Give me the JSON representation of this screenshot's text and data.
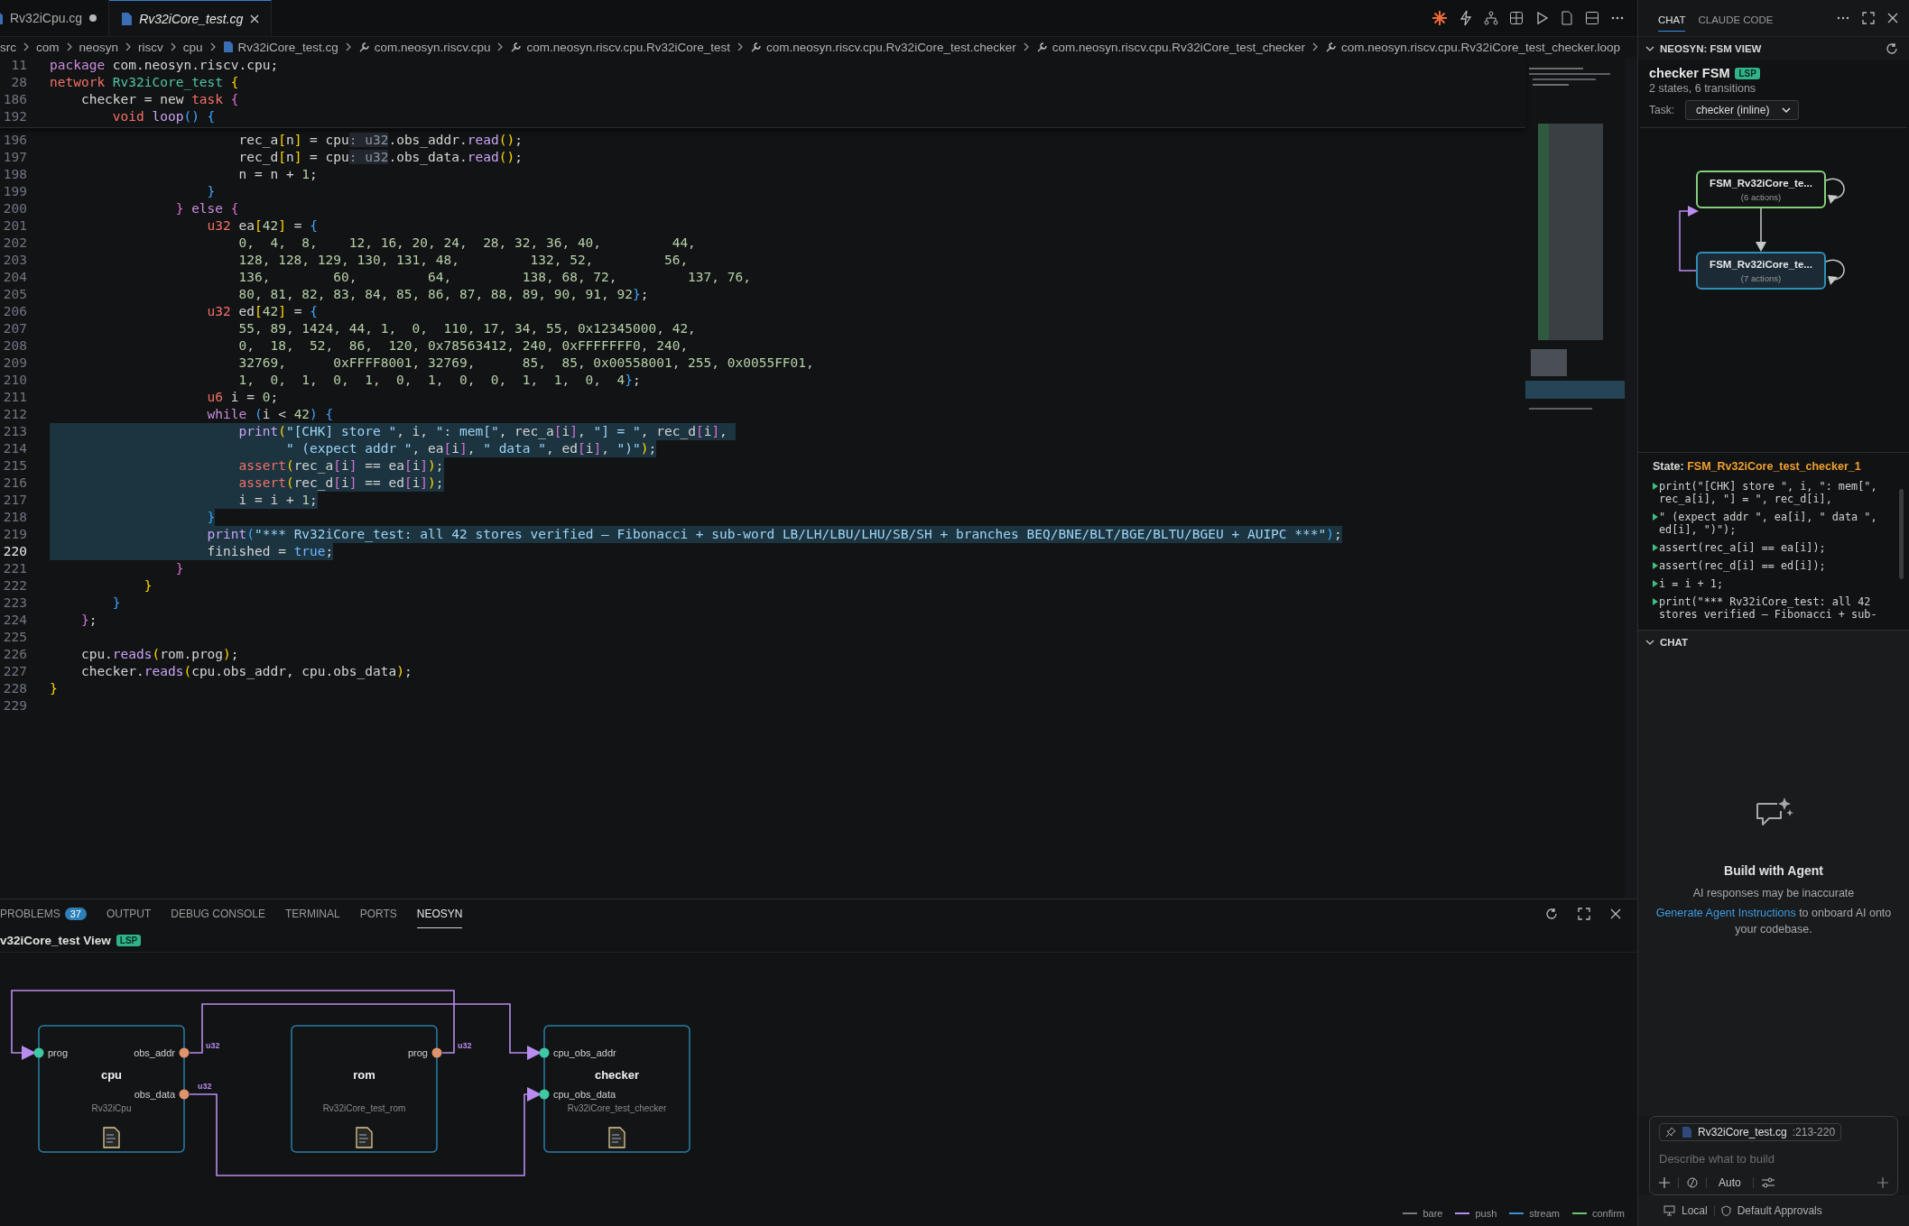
{
  "editor_tabs": [
    {
      "label": "Rv32iCpu.cg",
      "selected": false,
      "modified": true,
      "preview": false
    },
    {
      "label": "Rv32iCore_test.cg",
      "selected": true,
      "modified": false,
      "preview": true
    }
  ],
  "breadcrumbs": [
    {
      "label": "src",
      "kind": "folder"
    },
    {
      "label": "com",
      "kind": "folder"
    },
    {
      "label": "neosyn",
      "kind": "folder"
    },
    {
      "label": "riscv",
      "kind": "folder"
    },
    {
      "label": "cpu",
      "kind": "folder"
    },
    {
      "label": "Rv32iCore_test.cg",
      "kind": "file"
    },
    {
      "label": "com.neosyn.riscv.cpu",
      "kind": "symbol"
    },
    {
      "label": "com.neosyn.riscv.cpu.Rv32iCore_test",
      "kind": "symbol"
    },
    {
      "label": "com.neosyn.riscv.cpu.Rv32iCore_test.checker",
      "kind": "symbol"
    },
    {
      "label": "com.neosyn.riscv.cpu.Rv32iCore_test_checker",
      "kind": "symbol"
    },
    {
      "label": "com.neosyn.riscv.cpu.Rv32iCore_test_checker.loop",
      "kind": "symbol"
    }
  ],
  "sticky_lines": [
    {
      "num": "11",
      "tokens": [
        {
          "t": "package",
          "kind": "kw2"
        },
        {
          "t": " com.neosyn.riscv.cpu;",
          "kind": "plain"
        }
      ]
    },
    {
      "num": "28",
      "tokens": [
        {
          "t": "network ",
          "kind": "kw"
        },
        {
          "t": "Rv32iCore_test ",
          "kind": "type"
        },
        {
          "t": "{",
          "kind": "b1"
        }
      ]
    },
    {
      "num": "186",
      "tokens": [
        {
          "t": "    checker = new ",
          "kind": "plain"
        },
        {
          "t": "task ",
          "kind": "kw"
        },
        {
          "t": "{",
          "kind": "b2"
        }
      ]
    },
    {
      "num": "192",
      "tokens": [
        {
          "t": "        void ",
          "kind": "kw"
        },
        {
          "t": "loop",
          "kind": "fn"
        },
        {
          "t": "() {",
          "kind": "b3"
        }
      ]
    }
  ],
  "lines": [
    {
      "num": "196",
      "selected": false,
      "tokens": [
        {
          "t": "                        rec_a",
          "kind": "plain"
        },
        {
          "t": "[",
          "kind": "b1"
        },
        {
          "t": "n",
          "kind": "plain"
        },
        {
          "t": "]",
          "kind": "b1"
        },
        {
          "t": " = cpu",
          "kind": "plain"
        },
        {
          "t": ": u32",
          "kind": "hint"
        },
        {
          "t": ".obs_addr.",
          "kind": "plain"
        },
        {
          "t": "read",
          "kind": "fn"
        },
        {
          "t": "()",
          "kind": "b1"
        },
        {
          "t": ";",
          "kind": "plain"
        }
      ]
    },
    {
      "num": "197",
      "selected": false,
      "tokens": [
        {
          "t": "                        rec_d",
          "kind": "plain"
        },
        {
          "t": "[",
          "kind": "b1"
        },
        {
          "t": "n",
          "kind": "plain"
        },
        {
          "t": "]",
          "kind": "b1"
        },
        {
          "t": " = cpu",
          "kind": "plain"
        },
        {
          "t": ": u32",
          "kind": "hint"
        },
        {
          "t": ".obs_data.",
          "kind": "plain"
        },
        {
          "t": "read",
          "kind": "fn"
        },
        {
          "t": "()",
          "kind": "b1"
        },
        {
          "t": ";",
          "kind": "plain"
        }
      ]
    },
    {
      "num": "198",
      "selected": false,
      "tokens": [
        {
          "t": "                        n = n + ",
          "kind": "plain"
        },
        {
          "t": "1",
          "kind": "num"
        },
        {
          "t": ";",
          "kind": "plain"
        }
      ]
    },
    {
      "num": "199",
      "selected": false,
      "tokens": [
        {
          "t": "                    }",
          "kind": "b3"
        }
      ]
    },
    {
      "num": "200",
      "selected": false,
      "tokens": [
        {
          "t": "                }",
          "kind": "b2"
        },
        {
          "t": " else",
          "kind": "kw2"
        },
        {
          "t": " {",
          "kind": "b2"
        }
      ]
    },
    {
      "num": "201",
      "selected": false,
      "tokens": [
        {
          "t": "                    u32",
          "kind": "kw"
        },
        {
          "t": " ea",
          "kind": "plain"
        },
        {
          "t": "[",
          "kind": "b1"
        },
        {
          "t": "42",
          "kind": "num"
        },
        {
          "t": "]",
          "kind": "b1"
        },
        {
          "t": " = ",
          "kind": "plain"
        },
        {
          "t": "{",
          "kind": "b3"
        }
      ]
    },
    {
      "num": "202",
      "selected": false,
      "tokens": [
        {
          "t": "                        0,  4,  8,    12, 16, 20, 24,  28, 32, 36, 40,         44,",
          "kind": "num"
        }
      ]
    },
    {
      "num": "203",
      "selected": false,
      "tokens": [
        {
          "t": "                        128, 128, 129, 130, 131, 48,         132, 52,         56,",
          "kind": "num"
        }
      ]
    },
    {
      "num": "204",
      "selected": false,
      "tokens": [
        {
          "t": "                        136,        60,         64,         138, 68, 72,         137, 76,",
          "kind": "num"
        }
      ]
    },
    {
      "num": "205",
      "selected": false,
      "tokens": [
        {
          "t": "                        80, 81, 82, 83, 84, 85, 86, 87, 88, 89, 90, 91, 92",
          "kind": "num"
        },
        {
          "t": "}",
          "kind": "b3"
        },
        {
          "t": ";",
          "kind": "plain"
        }
      ]
    },
    {
      "num": "206",
      "selected": false,
      "tokens": [
        {
          "t": "                    u32",
          "kind": "kw"
        },
        {
          "t": " ed",
          "kind": "plain"
        },
        {
          "t": "[",
          "kind": "b1"
        },
        {
          "t": "42",
          "kind": "num"
        },
        {
          "t": "]",
          "kind": "b1"
        },
        {
          "t": " = ",
          "kind": "plain"
        },
        {
          "t": "{",
          "kind": "b3"
        }
      ]
    },
    {
      "num": "207",
      "selected": false,
      "tokens": [
        {
          "t": "                        55, 89, 1424, 44, 1,  0,  110, 17, 34, 55, 0x12345000, 42,",
          "kind": "num"
        }
      ]
    },
    {
      "num": "208",
      "selected": false,
      "tokens": [
        {
          "t": "                        0,  18,  52,  86,  120, 0x78563412, 240, 0xFFFFFFF0, 240,",
          "kind": "num"
        }
      ]
    },
    {
      "num": "209",
      "selected": false,
      "tokens": [
        {
          "t": "                        32769,      0xFFFF8001, 32769,      85,  85, 0x00558001, 255, 0x0055FF01,",
          "kind": "num"
        }
      ]
    },
    {
      "num": "210",
      "selected": false,
      "tokens": [
        {
          "t": "                        1,  0,  1,  0,  1,  0,  1,  0,  0,  1,  1,  0,  4",
          "kind": "num"
        },
        {
          "t": "}",
          "kind": "b3"
        },
        {
          "t": ";",
          "kind": "plain"
        }
      ]
    },
    {
      "num": "211",
      "selected": false,
      "tokens": [
        {
          "t": "                    u6",
          "kind": "kw"
        },
        {
          "t": " i = ",
          "kind": "plain"
        },
        {
          "t": "0",
          "kind": "num"
        },
        {
          "t": ";",
          "kind": "plain"
        }
      ]
    },
    {
      "num": "212",
      "selected": false,
      "tokens": [
        {
          "t": "                    while",
          "kind": "kw2"
        },
        {
          "t": " (",
          "kind": "b3"
        },
        {
          "t": "i < ",
          "kind": "plain"
        },
        {
          "t": "42",
          "kind": "num"
        },
        {
          "t": ") {",
          "kind": "b3"
        }
      ]
    },
    {
      "num": "213",
      "selected": true,
      "tokens": [
        {
          "t": "                        print",
          "kind": "fn"
        },
        {
          "t": "(",
          "kind": "b1"
        },
        {
          "t": "\"[CHK] store \"",
          "kind": "str"
        },
        {
          "t": ", i, ",
          "kind": "plain"
        },
        {
          "t": "\": mem[\"",
          "kind": "str"
        },
        {
          "t": ", rec_a",
          "kind": "plain"
        },
        {
          "t": "[",
          "kind": "b2"
        },
        {
          "t": "i",
          "kind": "plain"
        },
        {
          "t": "]",
          "kind": "b2"
        },
        {
          "t": ", ",
          "kind": "plain"
        },
        {
          "t": "\"] = \"",
          "kind": "str"
        },
        {
          "t": ", rec_d",
          "kind": "plain"
        },
        {
          "t": "[",
          "kind": "b2"
        },
        {
          "t": "i",
          "kind": "plain"
        },
        {
          "t": "]",
          "kind": "b2"
        },
        {
          "t": ", ",
          "kind": "plain"
        }
      ]
    },
    {
      "num": "214",
      "selected": true,
      "tokens": [
        {
          "t": "                              \" (expect addr \"",
          "kind": "str"
        },
        {
          "t": ", ea",
          "kind": "plain"
        },
        {
          "t": "[",
          "kind": "b2"
        },
        {
          "t": "i",
          "kind": "plain"
        },
        {
          "t": "]",
          "kind": "b2"
        },
        {
          "t": ", ",
          "kind": "plain"
        },
        {
          "t": "\" data \"",
          "kind": "str"
        },
        {
          "t": ", ed",
          "kind": "plain"
        },
        {
          "t": "[",
          "kind": "b2"
        },
        {
          "t": "i",
          "kind": "plain"
        },
        {
          "t": "]",
          "kind": "b2"
        },
        {
          "t": ", ",
          "kind": "plain"
        },
        {
          "t": "\")\"",
          "kind": "str"
        },
        {
          "t": ")",
          "kind": "b1"
        },
        {
          "t": ";",
          "kind": "plain"
        }
      ]
    },
    {
      "num": "215",
      "selected": true,
      "tokens": [
        {
          "t": "                        assert",
          "kind": "kw"
        },
        {
          "t": "(",
          "kind": "b1"
        },
        {
          "t": "rec_a",
          "kind": "plain"
        },
        {
          "t": "[",
          "kind": "b2"
        },
        {
          "t": "i",
          "kind": "plain"
        },
        {
          "t": "]",
          "kind": "b2"
        },
        {
          "t": " == ea",
          "kind": "plain"
        },
        {
          "t": "[",
          "kind": "b2"
        },
        {
          "t": "i",
          "kind": "plain"
        },
        {
          "t": "]",
          "kind": "b2"
        },
        {
          "t": ")",
          "kind": "b1"
        },
        {
          "t": ";",
          "kind": "plain"
        }
      ]
    },
    {
      "num": "216",
      "selected": true,
      "tokens": [
        {
          "t": "                        assert",
          "kind": "kw"
        },
        {
          "t": "(",
          "kind": "b1"
        },
        {
          "t": "rec_d",
          "kind": "plain"
        },
        {
          "t": "[",
          "kind": "b2"
        },
        {
          "t": "i",
          "kind": "plain"
        },
        {
          "t": "]",
          "kind": "b2"
        },
        {
          "t": " == ed",
          "kind": "plain"
        },
        {
          "t": "[",
          "kind": "b2"
        },
        {
          "t": "i",
          "kind": "plain"
        },
        {
          "t": "]",
          "kind": "b2"
        },
        {
          "t": ")",
          "kind": "b1"
        },
        {
          "t": ";",
          "kind": "plain"
        }
      ]
    },
    {
      "num": "217",
      "selected": true,
      "tokens": [
        {
          "t": "                        i = i + ",
          "kind": "plain"
        },
        {
          "t": "1",
          "kind": "num"
        },
        {
          "t": ";",
          "kind": "plain"
        }
      ]
    },
    {
      "num": "218",
      "selected": true,
      "tokens": [
        {
          "t": "                    }",
          "kind": "b3"
        }
      ]
    },
    {
      "num": "219",
      "selected": true,
      "tokens": [
        {
          "t": "                    print",
          "kind": "fn"
        },
        {
          "t": "(",
          "kind": "b3"
        },
        {
          "t": "\"*** Rv32iCore_test: all 42 stores verified — Fibonacci + sub-word LB/LH/LBU/LHU/SB/SH + branches BEQ/BNE/BLT/BGE/BLTU/BGEU + AUIPC ***\"",
          "kind": "str"
        },
        {
          "t": ")",
          "kind": "b3"
        },
        {
          "t": ";",
          "kind": "plain"
        }
      ]
    },
    {
      "num": "220",
      "selected": true,
      "tokens": [
        {
          "t": "                    finished = ",
          "kind": "plain"
        },
        {
          "t": "true",
          "kind": "const"
        },
        {
          "t": ";",
          "kind": "plain"
        }
      ]
    },
    {
      "num": "221",
      "selected": false,
      "tokens": [
        {
          "t": "                }",
          "kind": "b2"
        }
      ]
    },
    {
      "num": "222",
      "selected": false,
      "tokens": [
        {
          "t": "            }",
          "kind": "b1"
        }
      ]
    },
    {
      "num": "223",
      "selected": false,
      "tokens": [
        {
          "t": "        }",
          "kind": "b3"
        }
      ]
    },
    {
      "num": "224",
      "selected": false,
      "tokens": [
        {
          "t": "    }",
          "kind": "b2"
        },
        {
          "t": ";",
          "kind": "plain"
        }
      ]
    },
    {
      "num": "225",
      "selected": false
    },
    {
      "num": "226",
      "selected": false,
      "tokens": [
        {
          "t": "    cpu.",
          "kind": "plain"
        },
        {
          "t": "reads",
          "kind": "fn"
        },
        {
          "t": "(",
          "kind": "b1"
        },
        {
          "t": "rom.prog",
          "kind": "plain"
        },
        {
          "t": ")",
          "kind": "b1"
        },
        {
          "t": ";",
          "kind": "plain"
        }
      ]
    },
    {
      "num": "227",
      "selected": false,
      "tokens": [
        {
          "t": "    checker.",
          "kind": "plain"
        },
        {
          "t": "reads",
          "kind": "fn"
        },
        {
          "t": "(",
          "kind": "b1"
        },
        {
          "t": "cpu.obs_addr, cpu.obs_data",
          "kind": "plain"
        },
        {
          "t": ")",
          "kind": "b1"
        },
        {
          "t": ";",
          "kind": "plain"
        }
      ]
    },
    {
      "num": "228",
      "selected": false,
      "tokens": [
        {
          "t": "}",
          "kind": "b1"
        }
      ]
    },
    {
      "num": "229",
      "selected": false
    }
  ],
  "bottom_panel": {
    "tabs": [
      {
        "label": "PROBLEMS",
        "badge": "37",
        "selected": false
      },
      {
        "label": "OUTPUT",
        "selected": false
      },
      {
        "label": "DEBUG CONSOLE",
        "selected": false
      },
      {
        "label": "TERMINAL",
        "selected": false
      },
      {
        "label": "PORTS",
        "selected": false
      },
      {
        "label": "NEOSYN",
        "selected": true
      }
    ],
    "title": "v32iCore_test View",
    "badge": "LSP",
    "nodes": [
      {
        "name": "cpu",
        "type": "Rv32iCpu",
        "inputs": [
          "prog"
        ],
        "outputs": [
          "obs_addr",
          "obs_data"
        ]
      },
      {
        "name": "rom",
        "type": "Rv32iCore_test_rom",
        "outputs": [
          "prog"
        ]
      },
      {
        "name": "checker",
        "type": "Rv32iCore_test_checker",
        "inputs": [
          "cpu_obs_addr",
          "cpu_obs_data"
        ]
      }
    ],
    "edges": [
      {
        "label": "u32",
        "kind": "push"
      },
      {
        "label": "u32",
        "kind": "push"
      },
      {
        "label": "u32",
        "kind": "push"
      }
    ],
    "legend": [
      {
        "label": "bare",
        "color": "#7a7a7a"
      },
      {
        "label": "push",
        "color": "#b98cf0"
      },
      {
        "label": "stream",
        "color": "#3f8fd0"
      },
      {
        "label": "confirm",
        "color": "#6fc26f"
      }
    ]
  },
  "side_panel": {
    "tabs": [
      {
        "label": "CHAT",
        "selected": true
      },
      {
        "label": "CLAUDE CODE",
        "selected": false
      }
    ],
    "fsm": {
      "section": "NEOSYN: FSM VIEW",
      "title": "checker FSM",
      "badge": "LSP",
      "summary": "2 states, 6 transitions",
      "task_label": "Task:",
      "task_value": "checker (inline)",
      "states": [
        {
          "name": "FSM_Rv32iCore_te...",
          "actions": "(6 actions)",
          "initial": true,
          "selected": false
        },
        {
          "name": "FSM_Rv32iCore_te...",
          "actions": "(7 actions)",
          "initial": false,
          "selected": true
        }
      ],
      "state_label": "State:",
      "state_name": "FSM_Rv32iCore_test_checker_1",
      "actions": [
        "print(\"[CHK] store \", i, \": mem[\", rec_a[i], \"] = \", rec_d[i],",
        "\" (expect addr \", ea[i], \" data \", ed[i], \")\");",
        "assert(rec_a[i] == ea[i]);",
        "assert(rec_d[i] == ed[i]);",
        "i = i + 1;",
        "print(\"*** Rv32iCore_test: all 42 stores verified — Fibonacci + sub-"
      ]
    },
    "chat": {
      "section": "CHAT",
      "heading": "Build with Agent",
      "note": "AI responses may be inaccurate",
      "link": "Generate Agent Instructions",
      "link_tail": " to onboard AI onto your codebase.",
      "chip_file": "Rv32iCore_test.cg",
      "chip_range": ":213-220",
      "placeholder": "Describe what to build",
      "mode": "Auto",
      "footer": [
        "Local",
        "Default Approvals"
      ]
    }
  }
}
